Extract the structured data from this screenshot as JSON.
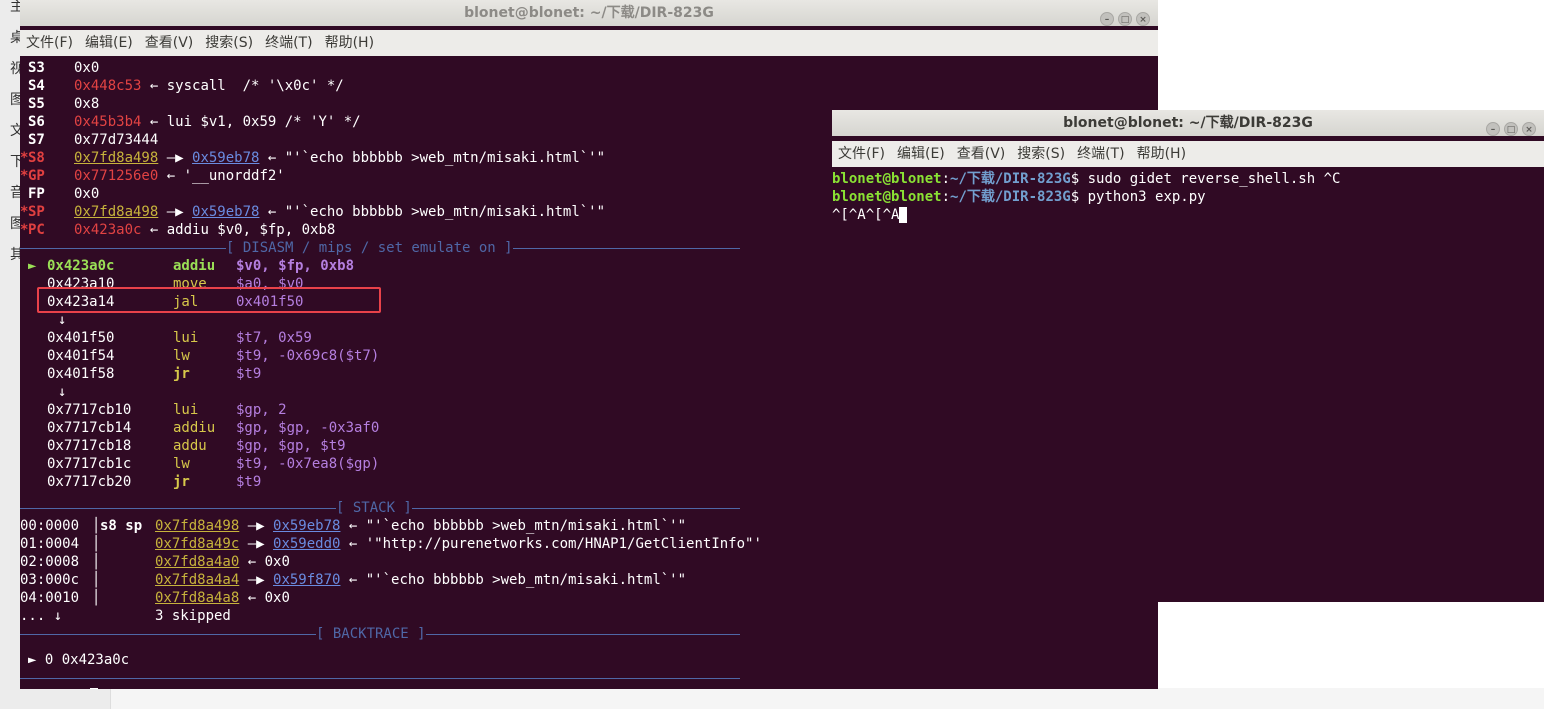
{
  "desktop": {
    "side_glyphs": [
      "主",
      "桌",
      "视",
      "图",
      "文",
      "下",
      "音",
      "图",
      "其"
    ]
  },
  "win1": {
    "title": "blonet@blonet: ~/下载/DIR-823G",
    "menu": [
      "文件(F)",
      "编辑(E)",
      "查看(V)",
      "搜索(S)",
      "终端(T)",
      "帮助(H)"
    ],
    "registers": [
      {
        "mark": "",
        "name": "S3",
        "val": "0x0",
        "rest": ""
      },
      {
        "mark": "",
        "name": "S4",
        "val": "0x448c53",
        "rest": " ← syscall  /* '\\x0c' */"
      },
      {
        "mark": "",
        "name": "S5",
        "val": "0x8",
        "rest": ""
      },
      {
        "mark": "",
        "name": "S6",
        "val": "0x45b3b4",
        "rest": " ← lui $v1, 0x59 /* 'Y' */"
      },
      {
        "mark": "",
        "name": "S7",
        "val": "0x77d73444",
        "rest": ""
      },
      {
        "mark": "*",
        "name": "S8",
        "val": "0x7fd8a498",
        "arrow": " —▶ ",
        "ptr": "0x59eb78",
        "rest": " ← \"'`echo bbbbbb >web_mtn/misaki.html`'\""
      },
      {
        "mark": "*",
        "name": "GP",
        "val": "0x771256e0",
        "rest": " ← '__unorddf2'"
      },
      {
        "mark": "",
        "name": "FP",
        "val": "0x0",
        "rest": ""
      },
      {
        "mark": "*",
        "name": "SP",
        "val": "0x7fd8a498",
        "arrow": " —▶ ",
        "ptr": "0x59eb78",
        "rest": " ← \"'`echo bbbbbb >web_mtn/misaki.html`'\""
      },
      {
        "mark": "*",
        "name": "PC",
        "val": "0x423a0c",
        "rest": " ← addiu $v0, $fp, 0xb8"
      }
    ],
    "disasm_label": "[ DISASM / mips / set emulate on ]",
    "disasm": [
      {
        "ptr": "►",
        "addr": "0x423a0c",
        "op": "addiu",
        "args": "$v0, $fp, 0xb8",
        "current": true
      },
      {
        "ptr": "",
        "addr": "0x423a10",
        "op": "move",
        "args": "$a0, $v0"
      },
      {
        "ptr": "",
        "addr": "0x423a14",
        "op": "jal",
        "args": "0x401f50"
      },
      {
        "ptr": "↓",
        "addr": "",
        "op": "",
        "args": ""
      },
      {
        "ptr": "",
        "addr": "0x401f50",
        "op": "lui",
        "args": "$t7, 0x59"
      },
      {
        "ptr": "",
        "addr": "0x401f54",
        "op": "lw",
        "args": "$t9, -0x69c8($t7)"
      },
      {
        "ptr": "",
        "addr": "0x401f58",
        "op": "jr",
        "args": "$t9"
      },
      {
        "ptr": "↓",
        "addr": "",
        "op": "",
        "args": ""
      },
      {
        "ptr": "",
        "addr": "0x7717cb10",
        "op": "lui",
        "args": "$gp, 2"
      },
      {
        "ptr": "",
        "addr": "0x7717cb14",
        "op": "addiu",
        "args": "$gp, $gp, -0x3af0"
      },
      {
        "ptr": "",
        "addr": "0x7717cb18",
        "op": "addu",
        "args": "$gp, $gp, $t9"
      },
      {
        "ptr": "",
        "addr": "0x7717cb1c",
        "op": "lw",
        "args": "$t9, -0x7ea8($gp)"
      },
      {
        "ptr": "",
        "addr": "0x7717cb20",
        "op": "jr",
        "args": "$t9"
      }
    ],
    "stack_label": "[ STACK ]",
    "stack": [
      {
        "off": "00:0000",
        "regs": "s8 sp",
        "addr": "0x7fd8a498",
        "arrow": " —▶ ",
        "ptr": "0x59eb78",
        "rest": " ← \"'`echo bbbbbb >web_mtn/misaki.html`'\""
      },
      {
        "off": "01:0004",
        "regs": "",
        "addr": "0x7fd8a49c",
        "arrow": " —▶ ",
        "ptr": "0x59edd0",
        "rest": " ← '\"http://purenetworks.com/HNAP1/GetClientInfo\"'"
      },
      {
        "off": "02:0008",
        "regs": "",
        "addr": "0x7fd8a4a0",
        "arrow": "",
        "ptr": "",
        "rest": " ← 0x0"
      },
      {
        "off": "03:000c",
        "regs": "",
        "addr": "0x7fd8a4a4",
        "arrow": " —▶ ",
        "ptr": "0x59f870",
        "rest": " ← \"'`echo bbbbbb >web_mtn/misaki.html`'\""
      },
      {
        "off": "04:0010",
        "regs": "",
        "addr": "0x7fd8a4a8",
        "arrow": "",
        "ptr": "",
        "rest": " ← 0x0"
      }
    ],
    "skipped_prefix": "... ↓",
    "skipped": "3 skipped",
    "backtrace_label": "[ BACKTRACE ]",
    "backtrace": "► 0 0x423a0c",
    "prompt": "pwndbg>"
  },
  "win2": {
    "title": "blonet@blonet: ~/下载/DIR-823G",
    "menu": [
      "文件(F)",
      "编辑(E)",
      "查看(V)",
      "搜索(S)",
      "终端(T)",
      "帮助(H)"
    ],
    "lines": [
      {
        "user": "blonet@blonet",
        "path": "~/下载/DIR-823G",
        "cmd": "$ sudo gidet reverse_shell.sh ^C"
      },
      {
        "user": "blonet@blonet",
        "path": "~/下载/DIR-823G",
        "cmd": "$ python3 exp.py"
      }
    ],
    "input_line": "^[^A^[^A"
  },
  "colors": {
    "terminal_bg": "#300a24",
    "highlight_box": "#e8424a",
    "separator": "#4f67a6"
  }
}
